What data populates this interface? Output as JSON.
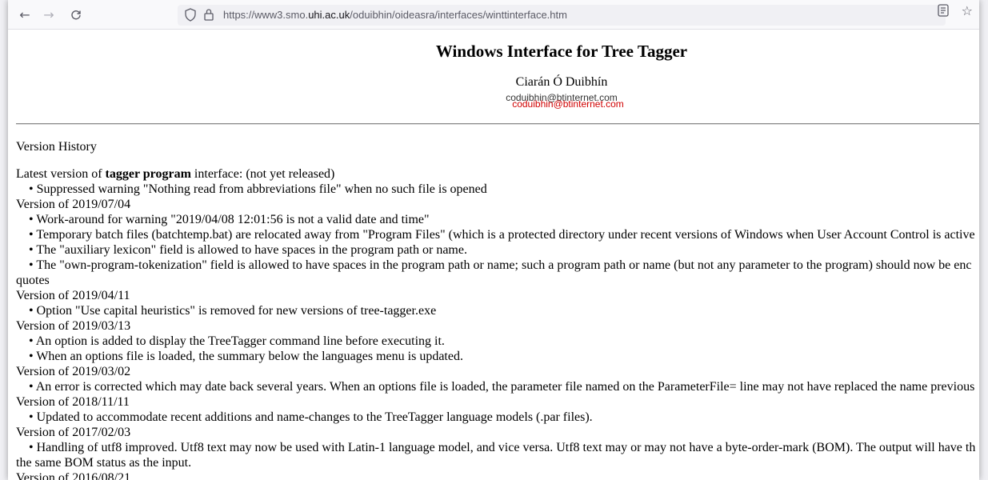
{
  "browser": {
    "url_prefix": "https://www3.smo.",
    "url_domain": "uhi.ac.uk",
    "url_suffix": "/oduibhin/oideasra/interfaces/winttinterface.htm",
    "icons": [
      "back-arrow-icon",
      "forward-arrow-icon",
      "reload-icon",
      "shield-icon",
      "lock-icon",
      "reader-view-icon",
      "bookmark-star-icon"
    ]
  },
  "page": {
    "title": "Windows Interface for Tree Tagger",
    "author": "Ciarán Ó Duibhín",
    "email_1": "coduibhin@btinternet.com",
    "email_2": "coduibhin@btinternet.com",
    "version_history_label": "Version History",
    "latest_prefix": "Latest version of ",
    "latest_bold": "tagger program",
    "latest_suffix": " interface: (not yet released)",
    "entries": [
      {
        "type": "bullet",
        "text": "• Suppressed warning \"Nothing read from abbreviations file\" when no such file is opened"
      },
      {
        "type": "version",
        "text": "Version of 2019/07/04"
      },
      {
        "type": "bullet",
        "text": "• Work-around for warning \"2019/04/08 12:01:56 is not a valid date and time\""
      },
      {
        "type": "bullet",
        "text": "• Temporary batch files (batchtemp.bat) are relocated away from \"Program Files\" (which is a protected directory under recent versions of Windows when User Account Control is active"
      },
      {
        "type": "bullet",
        "text": "• The \"auxiliary lexicon\" field is allowed to have spaces in the program path or name."
      },
      {
        "type": "bullet",
        "text": "• The \"own-program-tokenization\" field is allowed to have spaces in the program path or name; such a program path or name (but not any parameter to the program) should now be enc"
      },
      {
        "type": "wrap",
        "text": "quotes"
      },
      {
        "type": "version",
        "text": "Version of 2019/04/11"
      },
      {
        "type": "bullet",
        "text": "• Option \"Use capital heuristics\" is removed for new versions of tree-tagger.exe"
      },
      {
        "type": "version",
        "text": "Version of 2019/03/13"
      },
      {
        "type": "bullet",
        "text": "• An option is added to display the TreeTagger command line before executing it."
      },
      {
        "type": "bullet",
        "text": "• When an options file is loaded, the summary below the languages menu is updated."
      },
      {
        "type": "version",
        "text": "Version of 2019/03/02"
      },
      {
        "type": "bullet",
        "text": "• An error is corrected which may date back several years. When an options file is loaded, the parameter file named on the ParameterFile= line may not have replaced the name previous"
      },
      {
        "type": "version",
        "text": "Version of 2018/11/11"
      },
      {
        "type": "bullet",
        "text": "• Updated to accommodate recent additions and name-changes to the TreeTagger language models (.par files)."
      },
      {
        "type": "version",
        "text": "Version of 2017/02/03"
      },
      {
        "type": "bullet",
        "text": "• Handling of utf8 improved. Utf8 text may now be used with Latin-1 language model, and vice versa. Utf8 text may or may not have a byte-order-mark (BOM). The output will have th"
      },
      {
        "type": "wrap",
        "text": "the same BOM status as the input."
      },
      {
        "type": "version",
        "text": "Version of 2016/08/21"
      }
    ]
  }
}
